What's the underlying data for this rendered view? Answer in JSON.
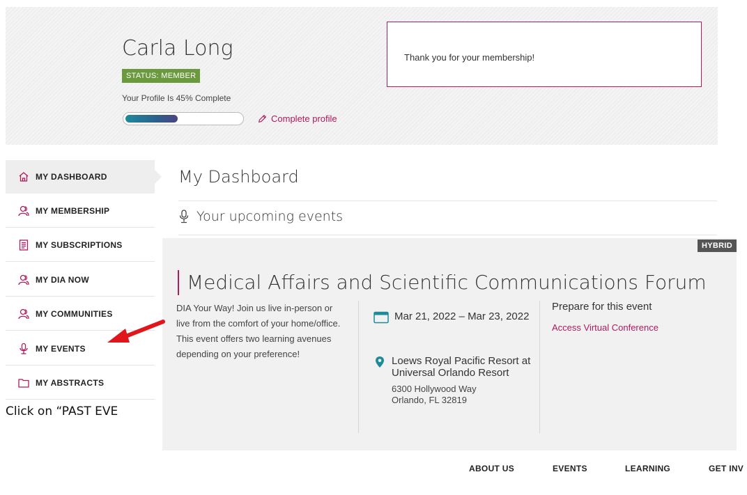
{
  "profile": {
    "name": "Carla Long",
    "status_badge": "STATUS: MEMBER",
    "completion_text": "Your Profile Is 45% Complete",
    "completion_fraction": 0.45,
    "complete_link": "Complete profile"
  },
  "notice": {
    "text": "Thank you for your membership!"
  },
  "sidebar": {
    "items": [
      {
        "label": "MY DASHBOARD",
        "icon": "home-icon",
        "active": true
      },
      {
        "label": "MY MEMBERSHIP",
        "icon": "user-group-icon"
      },
      {
        "label": "MY SUBSCRIPTIONS",
        "icon": "document-icon"
      },
      {
        "label": "MY DIA NOW",
        "icon": "user-group-icon"
      },
      {
        "label": "MY COMMUNITIES",
        "icon": "user-group-icon"
      },
      {
        "label": "MY EVENTS",
        "icon": "microphone-icon"
      },
      {
        "label": "MY ABSTRACTS",
        "icon": "folder-icon"
      }
    ]
  },
  "main": {
    "title": "My Dashboard",
    "section_label": "Your upcoming events"
  },
  "event": {
    "badge": "HYBRID",
    "title": "Medical Affairs and Scientific Communications Forum",
    "description": "DIA Your Way! Join us live in-person or live from the comfort of your home/office. This event offers two learning avenues depending on your preference!",
    "date_range": "Mar 21, 2022 – Mar 23, 2022",
    "venue": "Loews Royal Pacific Resort at Universal Orlando Resort",
    "address_line1": "6300 Hollywood Way",
    "address_line2": "Orlando, FL 32819",
    "prepare_label": "Prepare for this event",
    "access_link": "Access Virtual Conference"
  },
  "instruction": {
    "text": "Click on “PAST EVE"
  },
  "footer_nav": [
    "ABOUT US",
    "EVENTS",
    "LEARNING",
    "GET INV"
  ],
  "colors": {
    "accent": "#b0195c",
    "status_green": "#6a9a3d",
    "pin_teal": "#1e8a9a",
    "arrow_red": "#e0161b"
  }
}
